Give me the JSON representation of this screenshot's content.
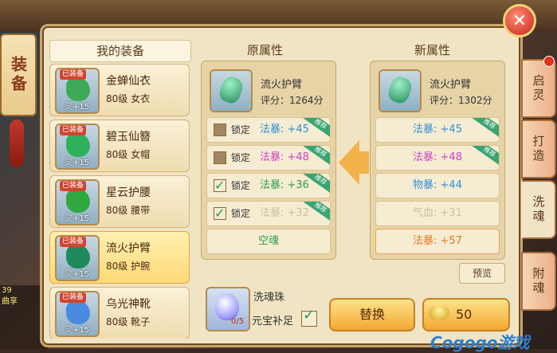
{
  "banner": {
    "title": "装备"
  },
  "close": {
    "icon": "✕"
  },
  "left": {
    "title": "我的装备",
    "items": [
      {
        "badge": "已装备",
        "level_tag": "灵+15",
        "name": "金蝉仙衣",
        "meta": "80级 女衣",
        "gem_color": "#3faa55"
      },
      {
        "badge": "已装备",
        "level_tag": "灵+15",
        "name": "碧玉仙簪",
        "meta": "80级 女帽",
        "gem_color": "#2fb05c"
      },
      {
        "badge": "已装备",
        "level_tag": "灵+15",
        "name": "星云护腰",
        "meta": "80级 腰带",
        "gem_color": "#30a840"
      },
      {
        "badge": "已装备",
        "level_tag": "灵+15",
        "name": "流火护臂",
        "meta": "80级 护腕",
        "gem_color": "#1f8a5a"
      },
      {
        "badge": "已装备",
        "level_tag": "灵+15",
        "name": "乌光神靴",
        "meta": "80级 靴子",
        "gem_color": "#4a8adf"
      }
    ]
  },
  "original": {
    "title": "原属性",
    "name": "流火护臂",
    "score": "评分：1264分",
    "lock_label": "锁定",
    "attrs": [
      {
        "text": "法暴: +45",
        "color": "#2f8fd8",
        "locked": false
      },
      {
        "text": "法暴: +48",
        "color": "#d040c8",
        "locked": false
      },
      {
        "text": "法暴: +36",
        "color": "#2aa050",
        "locked": true
      },
      {
        "text": "法暴: +32",
        "color": "#c9c0a4",
        "locked": true
      }
    ],
    "empty_label": "空魂",
    "ribbon": "推荐"
  },
  "new": {
    "title": "新属性",
    "name": "流火护臂",
    "score": "评分：1302分",
    "attrs": [
      {
        "text": "法暴: +45",
        "color": "#2f8fd8"
      },
      {
        "text": "法暴: +48",
        "color": "#d040c8"
      },
      {
        "text": "物暴: +44",
        "color": "#2f8fd8"
      },
      {
        "text": "气血: +31",
        "color": "#c9c0a4"
      },
      {
        "text": "法暴: +57",
        "color": "#e8761e"
      }
    ]
  },
  "preview": "预览",
  "pearl": {
    "name": "洗魂珠",
    "count": "0/5",
    "auto": "元宝补足"
  },
  "actions": {
    "replace": "替换",
    "cost": "50"
  },
  "tabs": [
    "启灵",
    "打造",
    "洗魂",
    "附魂"
  ],
  "watermark": "Cogogo游戏",
  "chat": [
    "39",
    "曲享"
  ]
}
